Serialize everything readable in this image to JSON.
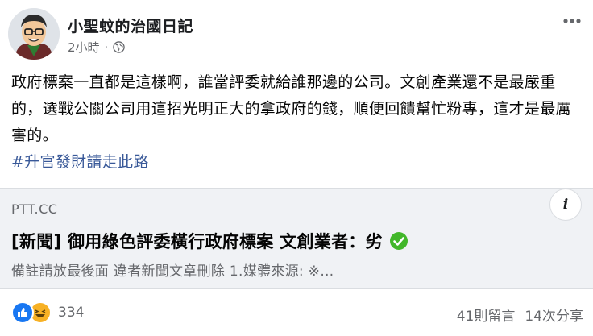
{
  "post": {
    "page_name": "小聖蚊的治國日記",
    "time": "2小時",
    "separator": "·",
    "text": "政府標案一直都是這樣啊，誰當評委就給誰那邊的公司。文創產業還不是最嚴重的，選戰公關公司用這招光明正大的拿政府的錢，順便回饋幫忙粉專，這才是最厲害的。",
    "hashtag": "#升官發財請走此路"
  },
  "link_card": {
    "domain": "PTT.CC",
    "title": "[新聞] 御用綠色評委橫行政府標案 文創業者：劣",
    "description": "備註請放最後面 違者新聞文章刪除 1.媒體來源: ※…",
    "info_label": "i"
  },
  "footer": {
    "reaction_count": "334",
    "comments": "41則留言",
    "shares": "14次分享"
  },
  "colors": {
    "link_blue": "#385898",
    "like_blue": "#1877f2",
    "haha_yellow": "#f7b125",
    "verified_green": "#42b72a",
    "secondary_text": "#65676b"
  },
  "icons": [
    "avatar-cartoon",
    "globe-icon",
    "more-icon",
    "info-icon",
    "check-circle-icon",
    "like-reaction-icon",
    "haha-reaction-icon"
  ]
}
